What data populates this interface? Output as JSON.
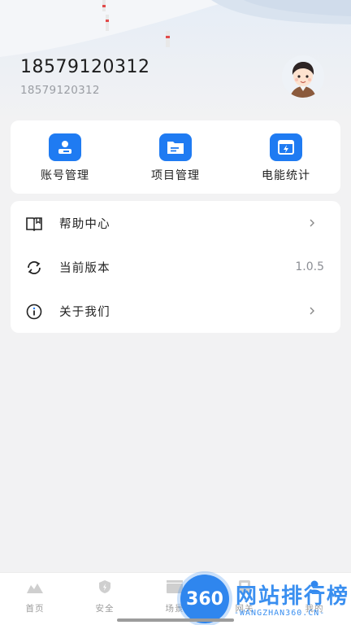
{
  "profile": {
    "phone": "18579120312",
    "subtitle": "18579120312"
  },
  "quick_actions": [
    {
      "label": "账号管理",
      "icon": "account-card-icon"
    },
    {
      "label": "项目管理",
      "icon": "folder-icon"
    },
    {
      "label": "电能统计",
      "icon": "power-stats-icon"
    }
  ],
  "menu": [
    {
      "label": "帮助中心",
      "icon": "book-icon",
      "value": ""
    },
    {
      "label": "当前版本",
      "icon": "refresh-icon",
      "value": "1.0.5"
    },
    {
      "label": "关于我们",
      "icon": "info-icon",
      "value": ""
    }
  ],
  "tabs": [
    {
      "label": "首页",
      "icon": "home-icon"
    },
    {
      "label": "安全",
      "icon": "shield-icon"
    },
    {
      "label": "场景",
      "icon": "scene-icon"
    },
    {
      "label": "网关",
      "icon": "gateway-icon"
    },
    {
      "label": "我的",
      "icon": "profile-icon"
    }
  ],
  "watermark": {
    "logo": "360",
    "text": "网站排行榜",
    "url": "-WANGZHAN360.CN-"
  },
  "colors": {
    "accent": "#1f7bf2",
    "background": "#f2f2f3",
    "card": "#ffffff"
  }
}
